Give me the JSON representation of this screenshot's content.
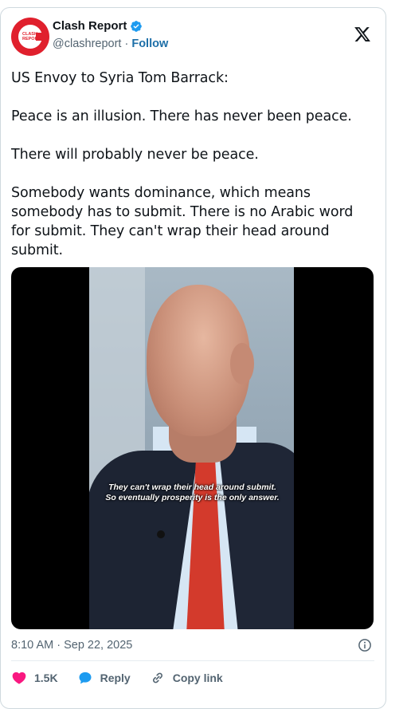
{
  "author": {
    "name": "Clash Report",
    "handle": "@clashreport",
    "separator": " · ",
    "follow_label": "Follow",
    "avatar_text_1": "CLASH",
    "avatar_text_2": "REPORT"
  },
  "tweet": {
    "text": "US Envoy to Syria Tom Barrack:\n\nPeace is an illusion. There has never been peace.\n\nThere will probably never be peace.\n\nSomebody wants dominance, which means somebody has to submit. There is no Arabic word for submit. They can't wrap their head around submit."
  },
  "media": {
    "caption_line1": "They can't wrap their head around submit.",
    "caption_line2": "So eventually prosperity is the only answer."
  },
  "timestamp": "8:10 AM · Sep 22, 2025",
  "actions": {
    "like_count": "1.5K",
    "reply_label": "Reply",
    "copy_label": "Copy link"
  },
  "colors": {
    "brand_red": "#e0202d",
    "verified_blue": "#1d9bf0",
    "like_pink": "#f91880",
    "link_blue": "#1d6fa8"
  }
}
